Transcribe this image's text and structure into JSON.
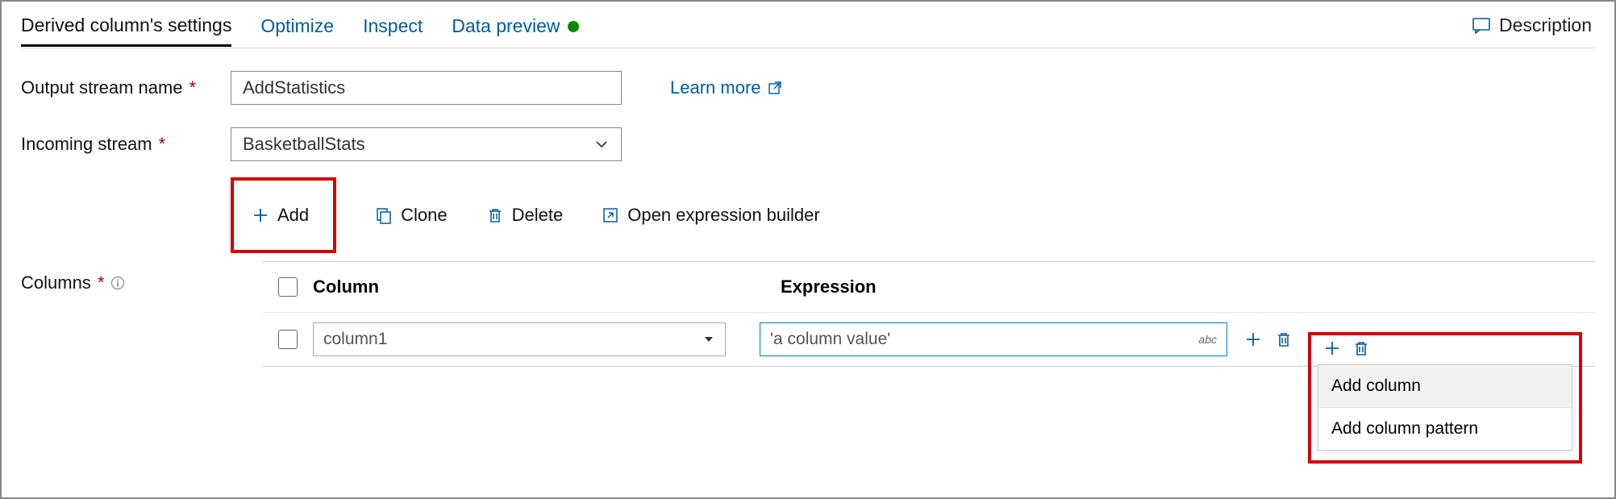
{
  "tabs": {
    "settings": "Derived column's settings",
    "optimize": "Optimize",
    "inspect": "Inspect",
    "preview": "Data preview"
  },
  "description_label": "Description",
  "labels": {
    "output_stream": "Output stream name",
    "incoming_stream": "Incoming stream",
    "columns": "Columns",
    "learn_more": "Learn more"
  },
  "fields": {
    "output_stream_value": "AddStatistics",
    "incoming_stream_value": "BasketballStats"
  },
  "toolbar": {
    "add": "Add",
    "clone": "Clone",
    "delete": "Delete",
    "builder": "Open expression builder"
  },
  "grid": {
    "headers": {
      "column": "Column",
      "expression": "Expression"
    },
    "rows": [
      {
        "column": "column1",
        "expression": "'a column value'",
        "type_hint": "abc"
      }
    ]
  },
  "menu": {
    "add_column": "Add column",
    "add_pattern": "Add column pattern"
  }
}
